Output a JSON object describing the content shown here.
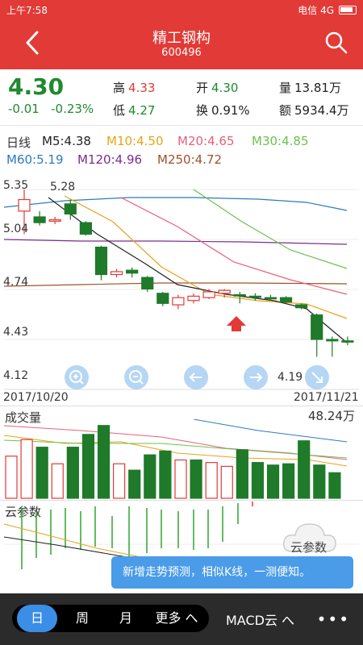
{
  "status": {
    "time": "上午7:58",
    "carrier": "电信 4G"
  },
  "header": {
    "title": "精工钢构",
    "code": "600496"
  },
  "quote": {
    "price": "4.30",
    "change": "-0.01",
    "change_pct": "-0.23%",
    "high_label": "高",
    "high": "4.33",
    "low_label": "低",
    "low": "4.27",
    "open_label": "开",
    "open": "4.30",
    "turnover_label": "换",
    "turnover": "0.91%",
    "volume_label": "量",
    "volume": "13.81万",
    "amount_label": "额",
    "amount": "5934.4万"
  },
  "ma": {
    "period": "日线",
    "ma5": "M5:4.38",
    "ma10": "M10:4.50",
    "ma20": "M20:4.65",
    "ma30": "M30:4.85",
    "ma60": "M60:5.19",
    "ma120": "M120:4.96",
    "ma250": "M250:4.72",
    "colors": {
      "ma5": "#222222",
      "ma10": "#e8a317",
      "ma20": "#e8607a",
      "ma30": "#6cc24a",
      "ma60": "#2a7bbf",
      "ma120": "#7a2d8f",
      "ma250": "#a0522d"
    }
  },
  "price_axis": {
    "p1": "5.35",
    "p2": "5.04",
    "p3": "4.74",
    "p4": "4.43",
    "p5": "4.12",
    "max_label": "5.28",
    "min_label": "4.19"
  },
  "date_axis": {
    "start": "2017/10/20",
    "end": "2017/11/21"
  },
  "volume_panel": {
    "label": "成交量",
    "value": "48.24万"
  },
  "cloud_panel": {
    "label": "云参数",
    "badge": "云参数"
  },
  "tooltip": {
    "text": "新增走势预测，相似K线，一测便知。"
  },
  "bottom_bar": {
    "tabs": [
      "日",
      "周",
      "月",
      "更多 へ"
    ],
    "active": "日",
    "indicator": "MACD云 へ",
    "more": "•••"
  },
  "icons": [
    "back-icon",
    "search-icon",
    "zoom-in-icon",
    "zoom-out-icon",
    "left-arrow-icon",
    "right-arrow-icon"
  ],
  "chart_data": {
    "type": "candlestick",
    "x_range": [
      "2017/10/20",
      "2017/11/21"
    ],
    "ylim": [
      4.12,
      5.35
    ],
    "candles": [
      {
        "o": 5.2,
        "h": 5.35,
        "l": 5.04,
        "c": 5.28,
        "up": true
      },
      {
        "o": 5.16,
        "h": 5.2,
        "l": 5.1,
        "c": 5.12,
        "up": false
      },
      {
        "o": 5.13,
        "h": 5.16,
        "l": 5.11,
        "c": 5.14,
        "up": true
      },
      {
        "o": 5.25,
        "h": 5.28,
        "l": 5.14,
        "c": 5.18,
        "up": false
      },
      {
        "o": 5.12,
        "h": 5.13,
        "l": 5.03,
        "c": 5.04,
        "up": false
      },
      {
        "o": 4.95,
        "h": 4.96,
        "l": 4.72,
        "c": 4.76,
        "up": false
      },
      {
        "o": 4.76,
        "h": 4.8,
        "l": 4.74,
        "c": 4.78,
        "up": true
      },
      {
        "o": 4.79,
        "h": 4.81,
        "l": 4.74,
        "c": 4.77,
        "up": false
      },
      {
        "o": 4.74,
        "h": 4.75,
        "l": 4.64,
        "c": 4.66,
        "up": false
      },
      {
        "o": 4.63,
        "h": 4.64,
        "l": 4.54,
        "c": 4.56,
        "up": false
      },
      {
        "o": 4.55,
        "h": 4.62,
        "l": 4.52,
        "c": 4.6,
        "up": true
      },
      {
        "o": 4.58,
        "h": 4.63,
        "l": 4.56,
        "c": 4.61,
        "up": true
      },
      {
        "o": 4.6,
        "h": 4.66,
        "l": 4.59,
        "c": 4.64,
        "up": true
      },
      {
        "o": 4.63,
        "h": 4.66,
        "l": 4.6,
        "c": 4.65,
        "up": true
      },
      {
        "o": 4.62,
        "h": 4.64,
        "l": 4.56,
        "c": 4.62,
        "up": false
      },
      {
        "o": 4.61,
        "h": 4.63,
        "l": 4.58,
        "c": 4.61,
        "up": false
      },
      {
        "o": 4.6,
        "h": 4.62,
        "l": 4.58,
        "c": 4.6,
        "up": false
      },
      {
        "o": 4.6,
        "h": 4.61,
        "l": 4.56,
        "c": 4.57,
        "up": false
      },
      {
        "o": 4.55,
        "h": 4.56,
        "l": 4.52,
        "c": 4.53,
        "up": false
      },
      {
        "o": 4.48,
        "h": 4.49,
        "l": 4.19,
        "c": 4.31,
        "up": false
      },
      {
        "o": 4.31,
        "h": 4.33,
        "l": 4.19,
        "c": 4.3,
        "up": false
      },
      {
        "o": 4.3,
        "h": 4.33,
        "l": 4.27,
        "c": 4.3,
        "up": false
      }
    ],
    "volume": [
      {
        "v": 33,
        "up": true
      },
      {
        "v": 46,
        "up": true
      },
      {
        "v": 40,
        "up": false
      },
      {
        "v": 27,
        "up": true
      },
      {
        "v": 40,
        "up": false
      },
      {
        "v": 50,
        "up": false
      },
      {
        "v": 57,
        "up": false
      },
      {
        "v": 27,
        "up": true
      },
      {
        "v": 22,
        "up": false
      },
      {
        "v": 34,
        "up": false
      },
      {
        "v": 37,
        "up": false
      },
      {
        "v": 30,
        "up": true
      },
      {
        "v": 30,
        "up": false
      },
      {
        "v": 28,
        "up": true
      },
      {
        "v": 25,
        "up": true
      },
      {
        "v": 38,
        "up": false
      },
      {
        "v": 28,
        "up": false
      },
      {
        "v": 26,
        "up": false
      },
      {
        "v": 27,
        "up": false
      },
      {
        "v": 45,
        "up": false
      },
      {
        "v": 26,
        "up": false
      },
      {
        "v": 20,
        "up": false
      }
    ],
    "vol_max": 60
  }
}
